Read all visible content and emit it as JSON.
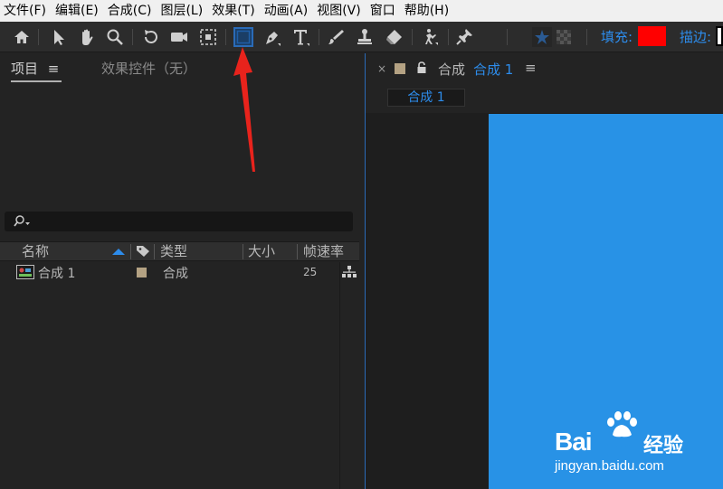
{
  "menubar": {
    "items": [
      "文件(F)",
      "编辑(E)",
      "合成(C)",
      "图层(L)",
      "效果(T)",
      "动画(A)",
      "视图(V)",
      "窗口",
      "帮助(H)"
    ]
  },
  "toolbar": {
    "tools": [
      "home-icon",
      "selection-icon",
      "hand-icon",
      "zoom-icon",
      "rotate-icon",
      "camera-icon",
      "pan-behind-icon",
      "rectangle-icon",
      "pen-icon",
      "text-icon",
      "brush-icon",
      "clone-stamp-icon",
      "eraser-icon",
      "roto-brush-icon",
      "puppet-pin-icon"
    ],
    "fill_label": "填充:",
    "stroke_label": "描边:",
    "fill_color": "#ff0000"
  },
  "left_panel": {
    "tab_project": "项目",
    "tab_effects": "效果控件（无）",
    "columns": [
      "名称",
      "类型",
      "大小",
      "帧速率"
    ],
    "items": [
      {
        "name": "合成 1",
        "type": "合成",
        "fps": "25"
      }
    ]
  },
  "right_panel": {
    "comp_tab_prefix": "合成",
    "comp_tab_name": "合成 1",
    "comp_subtab": "合成 1",
    "canvas_color": "#2892e6"
  },
  "watermark": {
    "brand_latin": "Bai",
    "brand_latin2": "du",
    "brand_cn": "经验",
    "url": "jingyan.baidu.com"
  }
}
